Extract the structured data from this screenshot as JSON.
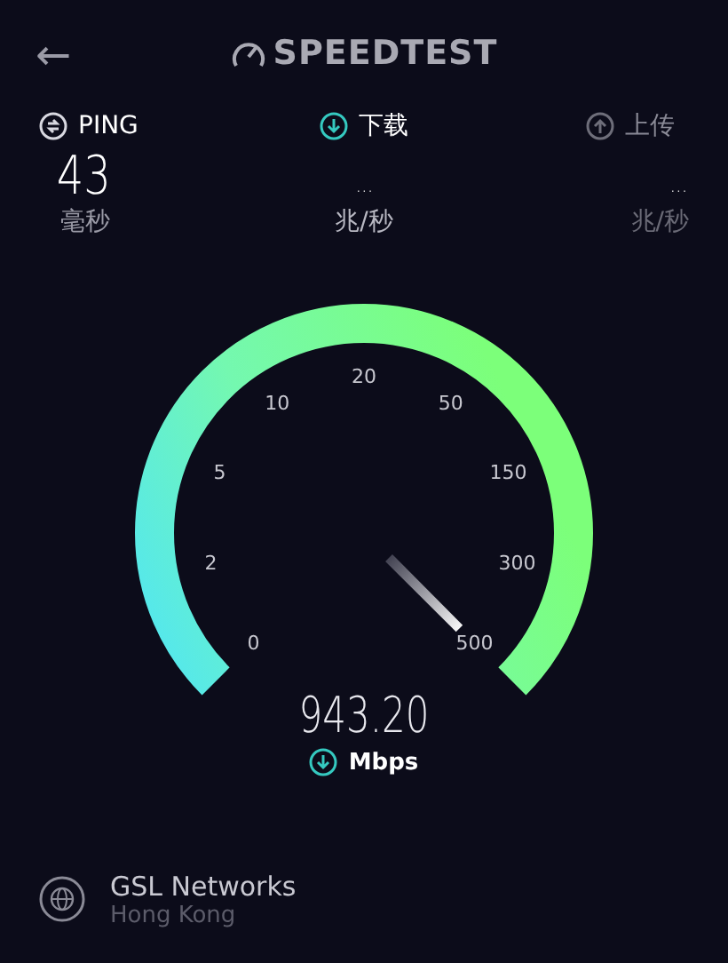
{
  "header": {
    "back": "←",
    "logo": "SPEEDTEST"
  },
  "metrics": [
    {
      "label": "PING",
      "kind": "done",
      "value": "43",
      "unit": "毫秒"
    },
    {
      "label": "下载",
      "kind": "active",
      "value": "...",
      "unit": "兆/秒"
    },
    {
      "label": "上传",
      "kind": "pending",
      "value": "...",
      "unit": "兆/秒"
    }
  ],
  "gauge": {
    "ticks": [
      "0",
      "2",
      "5",
      "10",
      "20",
      "50",
      "150",
      "300",
      "500"
    ],
    "reading": "943.20",
    "unit": "Mbps"
  },
  "server": {
    "name": "GSL Networks",
    "location": "Hong Kong"
  }
}
